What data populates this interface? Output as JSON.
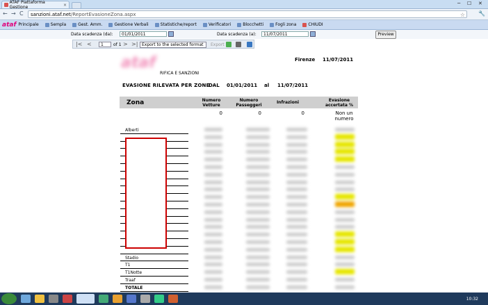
{
  "browser": {
    "tab_title": "ATAF Piattaforma Gestione",
    "tab_close": "×",
    "minimize": "─",
    "maximize": "☐",
    "close": "✕",
    "back": "←",
    "forward": "→",
    "reload": "C",
    "url_host": "sanzioni.ataf.net",
    "url_path": "/ReportEvasioneZona.aspx",
    "star": "☆"
  },
  "menu": {
    "logo": "ataf",
    "items": [
      {
        "label": "Principale"
      },
      {
        "label": "Sempla"
      },
      {
        "label": "Gest. Amm."
      },
      {
        "label": "Gestione Verbali"
      },
      {
        "label": "Statistiche/report"
      },
      {
        "label": "Verificatori"
      },
      {
        "label": "Blocchetti"
      },
      {
        "label": "Fogli zona"
      },
      {
        "label": "CHIUDI"
      }
    ]
  },
  "filters": {
    "from_label": "Data scadenza (da):",
    "from_value": "01/01/2011",
    "to_label": "Data scadenza (a):",
    "to_value": "11/07/2011",
    "preview_label": "Preview"
  },
  "viewer": {
    "first": "|<",
    "prev": "<",
    "page_value": "1",
    "page_of": "of 1",
    "next": ">",
    "last": ">|",
    "export_format": "Export to the selected format",
    "export_label": "Export"
  },
  "report": {
    "city": "Firenze",
    "date": "11/07/2011",
    "subtitle": "RIFICA E SANZIONI",
    "title": "EVASIONE RILEVATA PER ZONE",
    "dal": "DAL",
    "date_from": "01/01/2011",
    "al": "al",
    "date_to": "11/07/2011",
    "columns": {
      "zona": "Zona",
      "numero_vetture": "Numero Vetture",
      "numero_passeggeri": "Numero Passeggeri",
      "infrazioni": "Infrazioni",
      "evasione": "Evasione accertata %"
    },
    "first_row": {
      "vetture": "0",
      "passeggeri": "0",
      "infrazioni": "0",
      "evasione": "Non un numero"
    },
    "zones": [
      {
        "name": "Alberti"
      },
      {
        "name": ""
      },
      {
        "name": ""
      },
      {
        "name": ""
      },
      {
        "name": ""
      },
      {
        "name": ""
      },
      {
        "name": ""
      },
      {
        "name": ""
      },
      {
        "name": ""
      },
      {
        "name": ""
      },
      {
        "name": ""
      },
      {
        "name": ""
      },
      {
        "name": ""
      },
      {
        "name": ""
      },
      {
        "name": ""
      },
      {
        "name": ""
      },
      {
        "name": ""
      },
      {
        "name": "Stadio"
      },
      {
        "name": "T1"
      },
      {
        "name": "T1Notte"
      },
      {
        "name": "Traaf"
      },
      {
        "name": "TOTALE"
      }
    ]
  },
  "taskbar": {
    "clock": "10:32"
  },
  "colors": {
    "highlight_yellow": "#e6e600",
    "highlight_orange": "#f0a500",
    "redaction_border": "#cc0000",
    "header_gray": "#cfcfcf"
  }
}
